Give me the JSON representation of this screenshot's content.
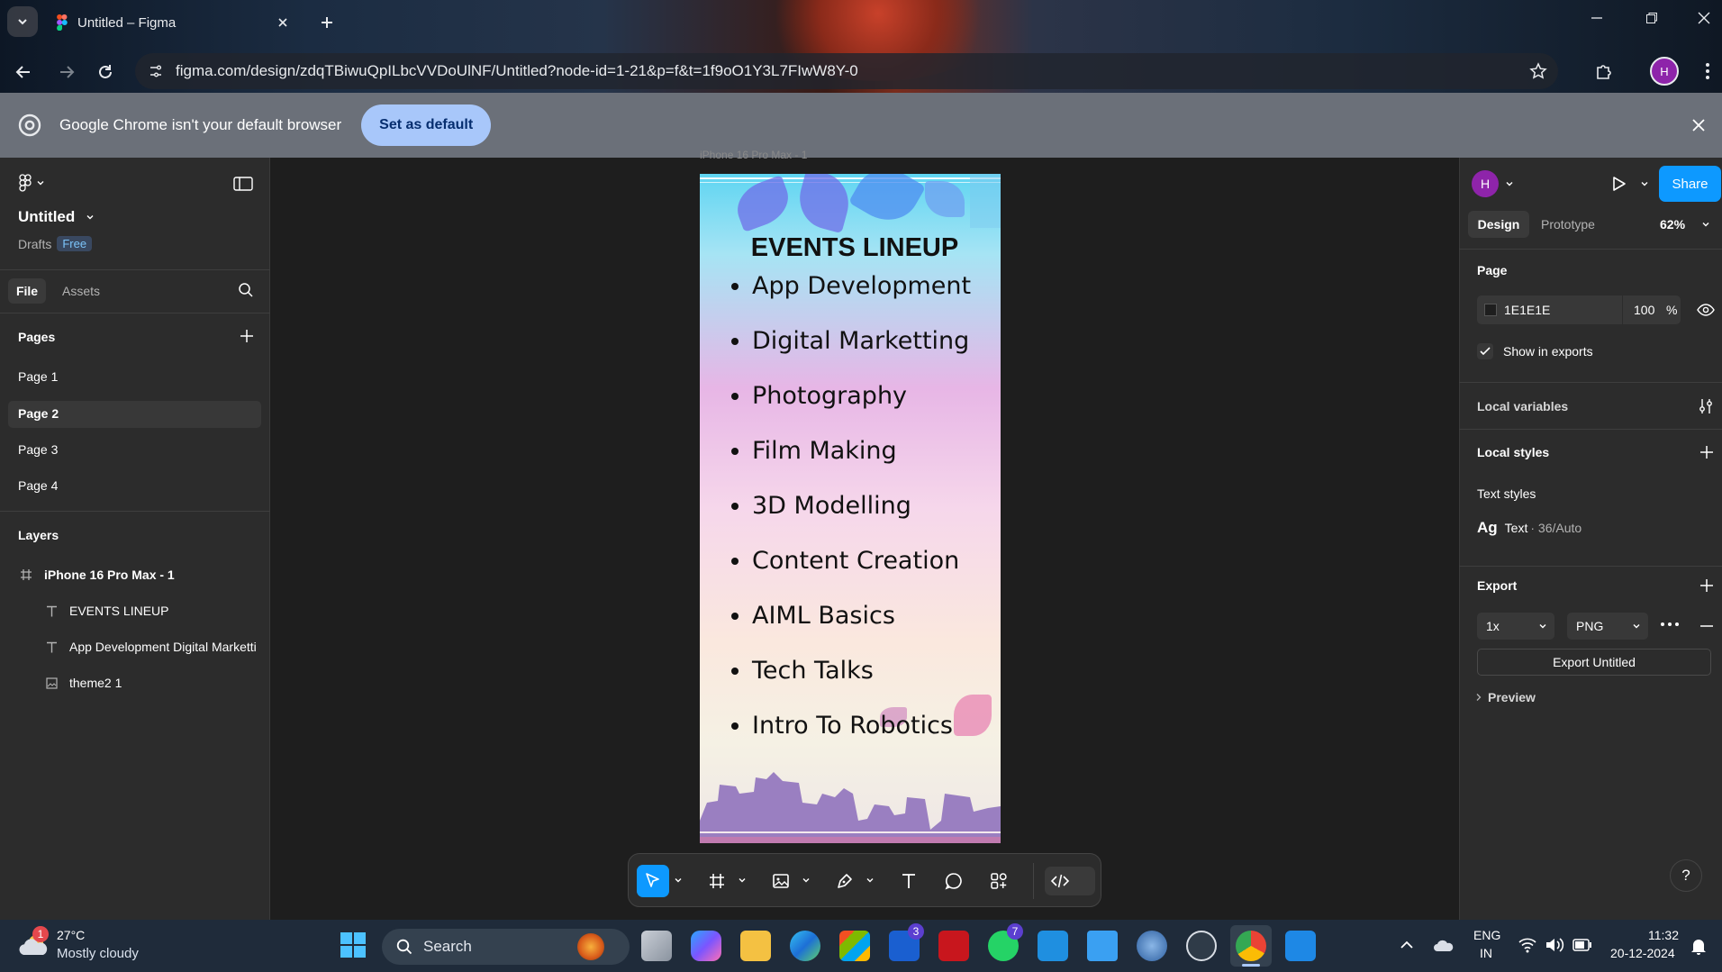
{
  "browser": {
    "tab_title": "Untitled – Figma",
    "url": "figma.com/design/zdqTBiwuQpILbcVVDoUlNF/Untitled?node-id=1-21&p=f&t=1f9oO1Y3L7FIwW8Y-0",
    "profile_initial": "H",
    "infobar_message": "Google Chrome isn't your default browser",
    "infobar_button": "Set as default"
  },
  "left_panel": {
    "file_name": "Untitled",
    "location": "Drafts",
    "plan_badge": "Free",
    "tabs": [
      "File",
      "Assets"
    ],
    "pages_heading": "Pages",
    "pages": [
      "Page 1",
      "Page 2",
      "Page 3",
      "Page 4"
    ],
    "selected_page": "Page 2",
    "layers_heading": "Layers",
    "layers": [
      {
        "icon": "frame-icon",
        "name": "iPhone 16 Pro Max - 1"
      },
      {
        "icon": "text-icon",
        "name": "EVENTS LINEUP"
      },
      {
        "icon": "text-icon",
        "name": "App Development Digital Marketti"
      },
      {
        "icon": "image-icon",
        "name": "theme2 1"
      }
    ]
  },
  "canvas": {
    "frame_label": "iPhone 16 Pro Max - 1",
    "poster_title": "EVENTS LINEUP",
    "poster_items": [
      "App Development",
      "Digital Marketting",
      "Photography",
      "Film Making",
      "3D Modelling",
      "Content Creation",
      "AIML Basics",
      "Tech Talks",
      "Intro To Robotics"
    ]
  },
  "right_panel": {
    "user_initial": "H",
    "share_label": "Share",
    "tabs": [
      "Design",
      "Prototype"
    ],
    "zoom": "62%",
    "page_heading": "Page",
    "page_color": "1E1E1E",
    "page_opacity": "100",
    "percent_sign": "%",
    "show_in_exports": "Show in exports",
    "local_variables": "Local variables",
    "local_styles": "Local styles",
    "text_styles": "Text styles",
    "text_style_glyph": "Ag",
    "text_style_name": "Text",
    "text_style_detail": "· 36/Auto",
    "export_heading": "Export",
    "export_scale": "1x",
    "export_format": "PNG",
    "export_button": "Export Untitled",
    "preview": "Preview",
    "help": "?"
  },
  "taskbar": {
    "weather_temp": "27°C",
    "weather_desc": "Mostly cloudy",
    "weather_badge": "1",
    "search_placeholder": "Search",
    "teams_badge": "3",
    "whatsapp_badge": "7",
    "language": "ENG",
    "region": "IN",
    "time": "11:32",
    "date": "20-12-2024"
  },
  "colors": {
    "figma_blue": "#0d99ff",
    "panel_bg": "#2c2c2c",
    "canvas_bg": "#1e1e1e",
    "profile_purple": "#8e24aa"
  }
}
